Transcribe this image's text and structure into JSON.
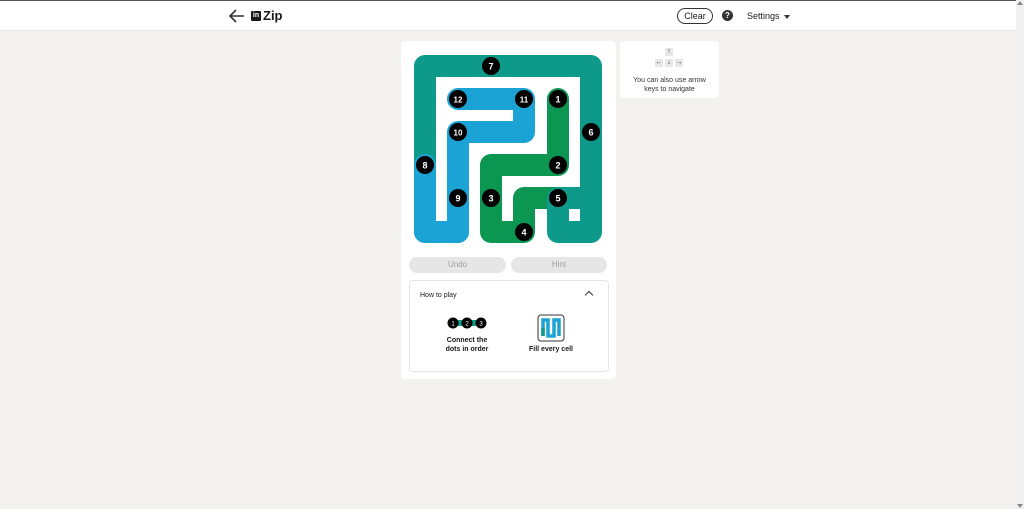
{
  "header": {
    "back_icon": "arrow-left-icon",
    "logo_text": "in",
    "title": "Zip",
    "clear_label": "Clear",
    "help_icon": "question-circle-icon",
    "settings_label": "Settings"
  },
  "board": {
    "grid_size": 6,
    "numbers": [
      "1",
      "2",
      "3",
      "4",
      "5",
      "6",
      "7",
      "8",
      "9",
      "10",
      "11",
      "12"
    ],
    "colors": {
      "teal": "#0e9a8a",
      "blue": "#1aa3d4",
      "green": "#0b9652",
      "dot": "#000000",
      "wall": "#ffffff"
    }
  },
  "actions": {
    "undo_label": "Undo",
    "hint_label": "Hint"
  },
  "how_to_play": {
    "title": "How to play",
    "step1_dots": [
      "1",
      "2",
      "3"
    ],
    "step1_label_line1": "Connect the",
    "step1_label_line2": "dots in order",
    "step2_label": "Fill every cell"
  },
  "tip": {
    "keys": {
      "up": "↑",
      "left": "←",
      "down": "↓",
      "right": "→"
    },
    "line1": "You can also use arrow",
    "line2": "keys to navigate"
  }
}
